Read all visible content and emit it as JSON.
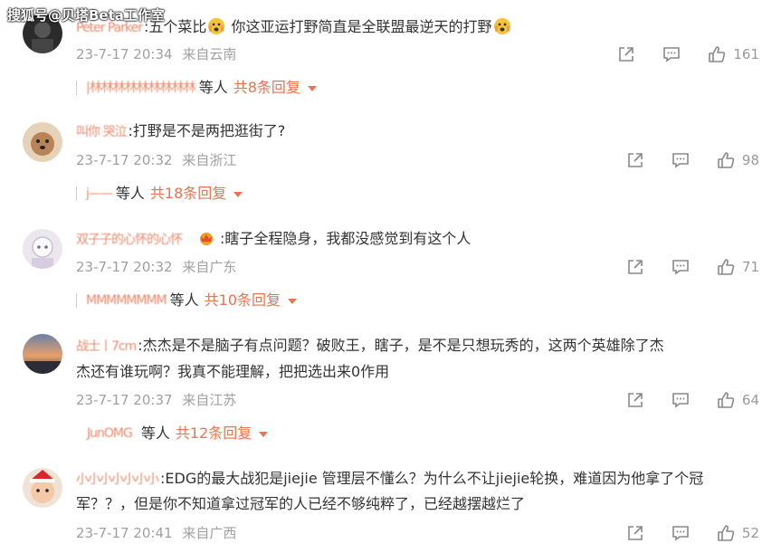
{
  "watermark": "搜狐号@贝塔Beta工作室",
  "comments": [
    {
      "nickname": "Peter Parker",
      "text_prefix": ":五个菜比",
      "text_suffix": " 你这亚运打野简直是全联盟最逆天的打野",
      "time": "23-7-17 20:34",
      "location": "来自云南",
      "likes": "161",
      "reply_nick": "|林林林林林林林林林",
      "reply_deng": "等人",
      "reply_count": "共8条回复"
    },
    {
      "nickname": "叫你 哭泣",
      "text": ":打野是不是两把逛街了?",
      "time": "23-7-17 20:32",
      "location": "来自浙江",
      "likes": "98",
      "reply_nick": "j——",
      "reply_deng": "等人",
      "reply_count": "共18条回复"
    },
    {
      "nickname": "双子子的心怀的心怀",
      "text": ":瞎子全程隐身，我都没感觉到有这个人",
      "time": "23-7-17 20:32",
      "location": "来自广东",
      "likes": "71",
      "reply_nick": "MMMMMMMM",
      "reply_deng": "等人",
      "reply_count": "共10条回复"
    },
    {
      "nickname": "战士丨7cm",
      "text_line1": ":杰杰是不是脑子有点问题？破败王，瞎子，是不是只想玩秀的，这两个英雄除了杰",
      "text_line2": "杰还有谁玩啊？我真不能理解，把把选出来0作用",
      "time": "23-7-17 20:37",
      "location": "来自江苏",
      "likes": "64",
      "reply_nick": "JunOMG",
      "reply_deng": "等人",
      "reply_count": "共12条回复"
    },
    {
      "nickname": "小小小小小小小",
      "text_line1": ":EDG的最大战犯是jiejie 管理层不懂么？为什么不让jiejie轮换，难道因为他拿了个冠",
      "text_line2": "军？？，但是你不知道拿过冠军的人已经不够纯粹了，已经越摆越烂了",
      "time": "23-7-17 20:41",
      "location": "来自广西",
      "likes": "52"
    }
  ],
  "icons": {
    "share": "share-icon",
    "comment": "comment-icon",
    "like": "thumbs-up-icon"
  },
  "colors": {
    "accent": "#eb7350",
    "meta": "#a0a0a0"
  }
}
